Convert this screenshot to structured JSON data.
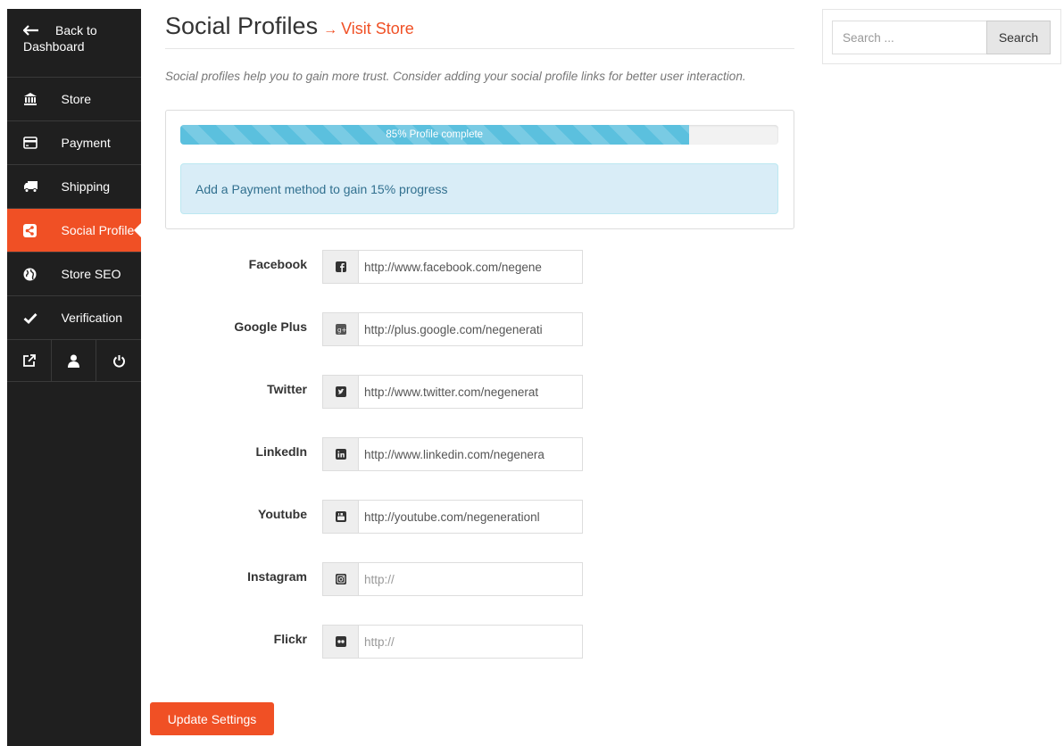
{
  "sidebar": {
    "back": {
      "label_line1": "Back to",
      "label_line2": "Dashboard",
      "icon": "arrow-left-icon"
    },
    "items": [
      {
        "label": "Store",
        "icon": "bank-icon"
      },
      {
        "label": "Payment",
        "icon": "credit-card-icon"
      },
      {
        "label": "Shipping",
        "icon": "truck-icon"
      },
      {
        "label": "Social Profile",
        "icon": "share-icon",
        "active": true
      },
      {
        "label": "Store SEO",
        "icon": "globe-icon"
      },
      {
        "label": "Verification",
        "icon": "check-icon"
      }
    ],
    "bottom_icons": [
      "external-link-icon",
      "user-icon",
      "power-icon"
    ]
  },
  "header": {
    "title": "Social Profiles",
    "arrow": "→",
    "visit_store": "Visit Store"
  },
  "intro": "Social profiles help you to gain more trust. Consider adding your social profile links for better user interaction.",
  "progress": {
    "value_percent": 85,
    "label": "85% Profile complete",
    "hint": "Add a Payment method to gain 15% progress"
  },
  "fields": [
    {
      "label": "Facebook",
      "value": "http://www.facebook.com/negene",
      "placeholder": "http://",
      "icon": "facebook-icon"
    },
    {
      "label": "Google Plus",
      "value": "http://plus.google.com/negenerati",
      "placeholder": "http://",
      "icon": "google-plus-icon"
    },
    {
      "label": "Twitter",
      "value": "http://www.twitter.com/negenerat",
      "placeholder": "http://",
      "icon": "twitter-icon"
    },
    {
      "label": "LinkedIn",
      "value": "http://www.linkedin.com/negenera",
      "placeholder": "http://",
      "icon": "linkedin-icon"
    },
    {
      "label": "Youtube",
      "value": "http://youtube.com/negenerationl",
      "placeholder": "http://",
      "icon": "youtube-icon"
    },
    {
      "label": "Instagram",
      "value": "",
      "placeholder": "http://",
      "icon": "instagram-icon"
    },
    {
      "label": "Flickr",
      "value": "",
      "placeholder": "http://",
      "icon": "flickr-icon"
    }
  ],
  "update_button": "Update Settings",
  "search": {
    "placeholder": "Search ...",
    "button": "Search"
  },
  "colors": {
    "accent": "#f05025",
    "sidebar": "#1f1f1f",
    "progress": "#5bc0de",
    "alert_bg": "#d9edf7",
    "alert_text": "#31708f"
  }
}
